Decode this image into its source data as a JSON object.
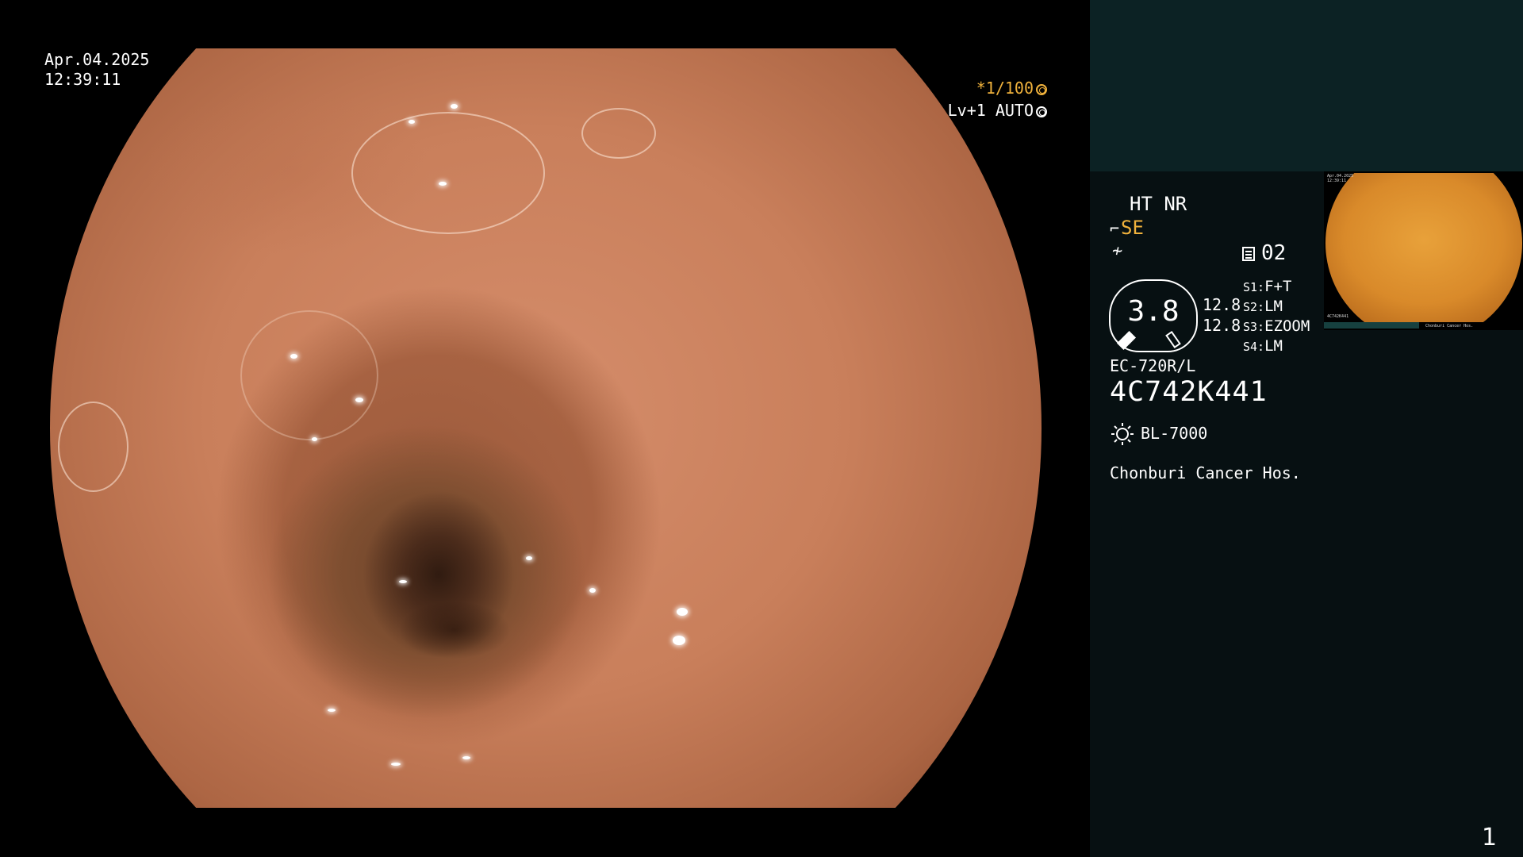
{
  "overlay": {
    "date": "Apr.04.2025",
    "time": "12:39:11",
    "shutter_label": "*1/100",
    "level_label": "Lv+1 AUTO"
  },
  "panel": {
    "mode_text": "HT NR",
    "se_label": "SE",
    "slot_label": "02",
    "gauge_value": "3.8",
    "gauge_numbers": [
      "12.8",
      "12.8"
    ],
    "switches": [
      {
        "key": "S1:",
        "value": "F+T"
      },
      {
        "key": "S2:",
        "value": "LM"
      },
      {
        "key": "S3:",
        "value": "EZOOM"
      },
      {
        "key": "S4:",
        "value": "LM"
      }
    ],
    "scope_model": "EC-720R/L",
    "scope_serial": "4C742K441",
    "light_source": "BL-7000",
    "hospital": "Chonburi Cancer Hos.",
    "page_number": "1"
  },
  "thumbnail": {
    "date": "Apr.04.2025",
    "time": "12:39:11",
    "serial": "4C742K441",
    "hospital": "Chonburi Cancer Hos."
  },
  "colors": {
    "accent": "#f0b23c",
    "panel_bg": "#071012",
    "panel_top_bg": "#0c2224"
  }
}
